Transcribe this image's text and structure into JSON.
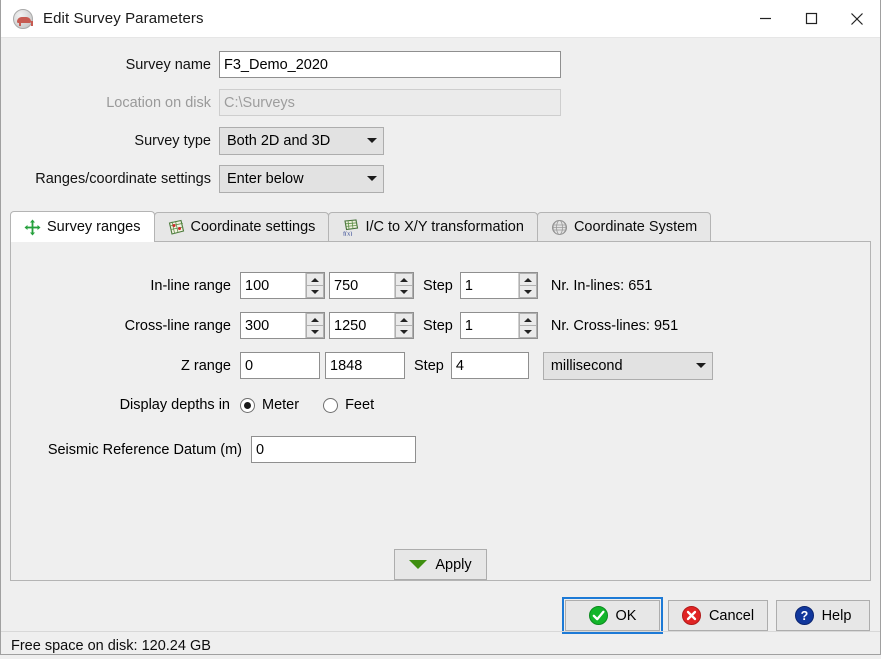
{
  "window": {
    "title": "Edit Survey Parameters",
    "icon": "survey-app-icon",
    "controls": {
      "minimize": "–",
      "maximize": "□",
      "close": "✕"
    }
  },
  "form": {
    "survey_name": {
      "label": "Survey name",
      "value": "F3_Demo_2020"
    },
    "location": {
      "label": "Location on disk",
      "value": "C:\\Surveys",
      "disabled": true
    },
    "survey_type": {
      "label": "Survey type",
      "value": "Both 2D and 3D"
    },
    "ranges_settings": {
      "label": "Ranges/coordinate settings",
      "value": "Enter below"
    }
  },
  "tabs": [
    {
      "label": "Survey ranges",
      "icon": "four-way-arrow-icon",
      "active": true
    },
    {
      "label": "Coordinate settings",
      "icon": "grid-map-icon",
      "active": false
    },
    {
      "label": "I/C to X/Y transformation",
      "icon": "function-grid-icon",
      "active": false
    },
    {
      "label": "Coordinate System",
      "icon": "globe-icon",
      "active": false
    }
  ],
  "ranges": {
    "inline": {
      "label": "In-line range",
      "start": "100",
      "stop": "750",
      "step_label": "Step",
      "step": "1",
      "count_text": "Nr. In-lines: 651"
    },
    "crossline": {
      "label": "Cross-line range",
      "start": "300",
      "stop": "1250",
      "step_label": "Step",
      "step": "1",
      "count_text": "Nr. Cross-lines: 951"
    },
    "zrange": {
      "label": "Z range",
      "start": "0",
      "stop": "1848",
      "step_label": "Step",
      "step": "4",
      "unit": "millisecond"
    }
  },
  "display_depths": {
    "label": "Display depths in",
    "options": [
      {
        "label": "Meter",
        "selected": true
      },
      {
        "label": "Feet",
        "selected": false
      }
    ]
  },
  "seismic_reference_datum": {
    "label": "Seismic Reference Datum (m)",
    "value": "0"
  },
  "buttons": {
    "apply": "Apply",
    "ok": "OK",
    "cancel": "Cancel",
    "help": "Help"
  },
  "statusbar": {
    "text": "Free space on disk: 120.24 GB"
  },
  "colors": {
    "accent_green": "#3f8f10",
    "ok_green": "#12b52a",
    "cancel_red": "#e02424",
    "help_blue": "#11379c",
    "focus_blue": "#1d7ad6"
  }
}
